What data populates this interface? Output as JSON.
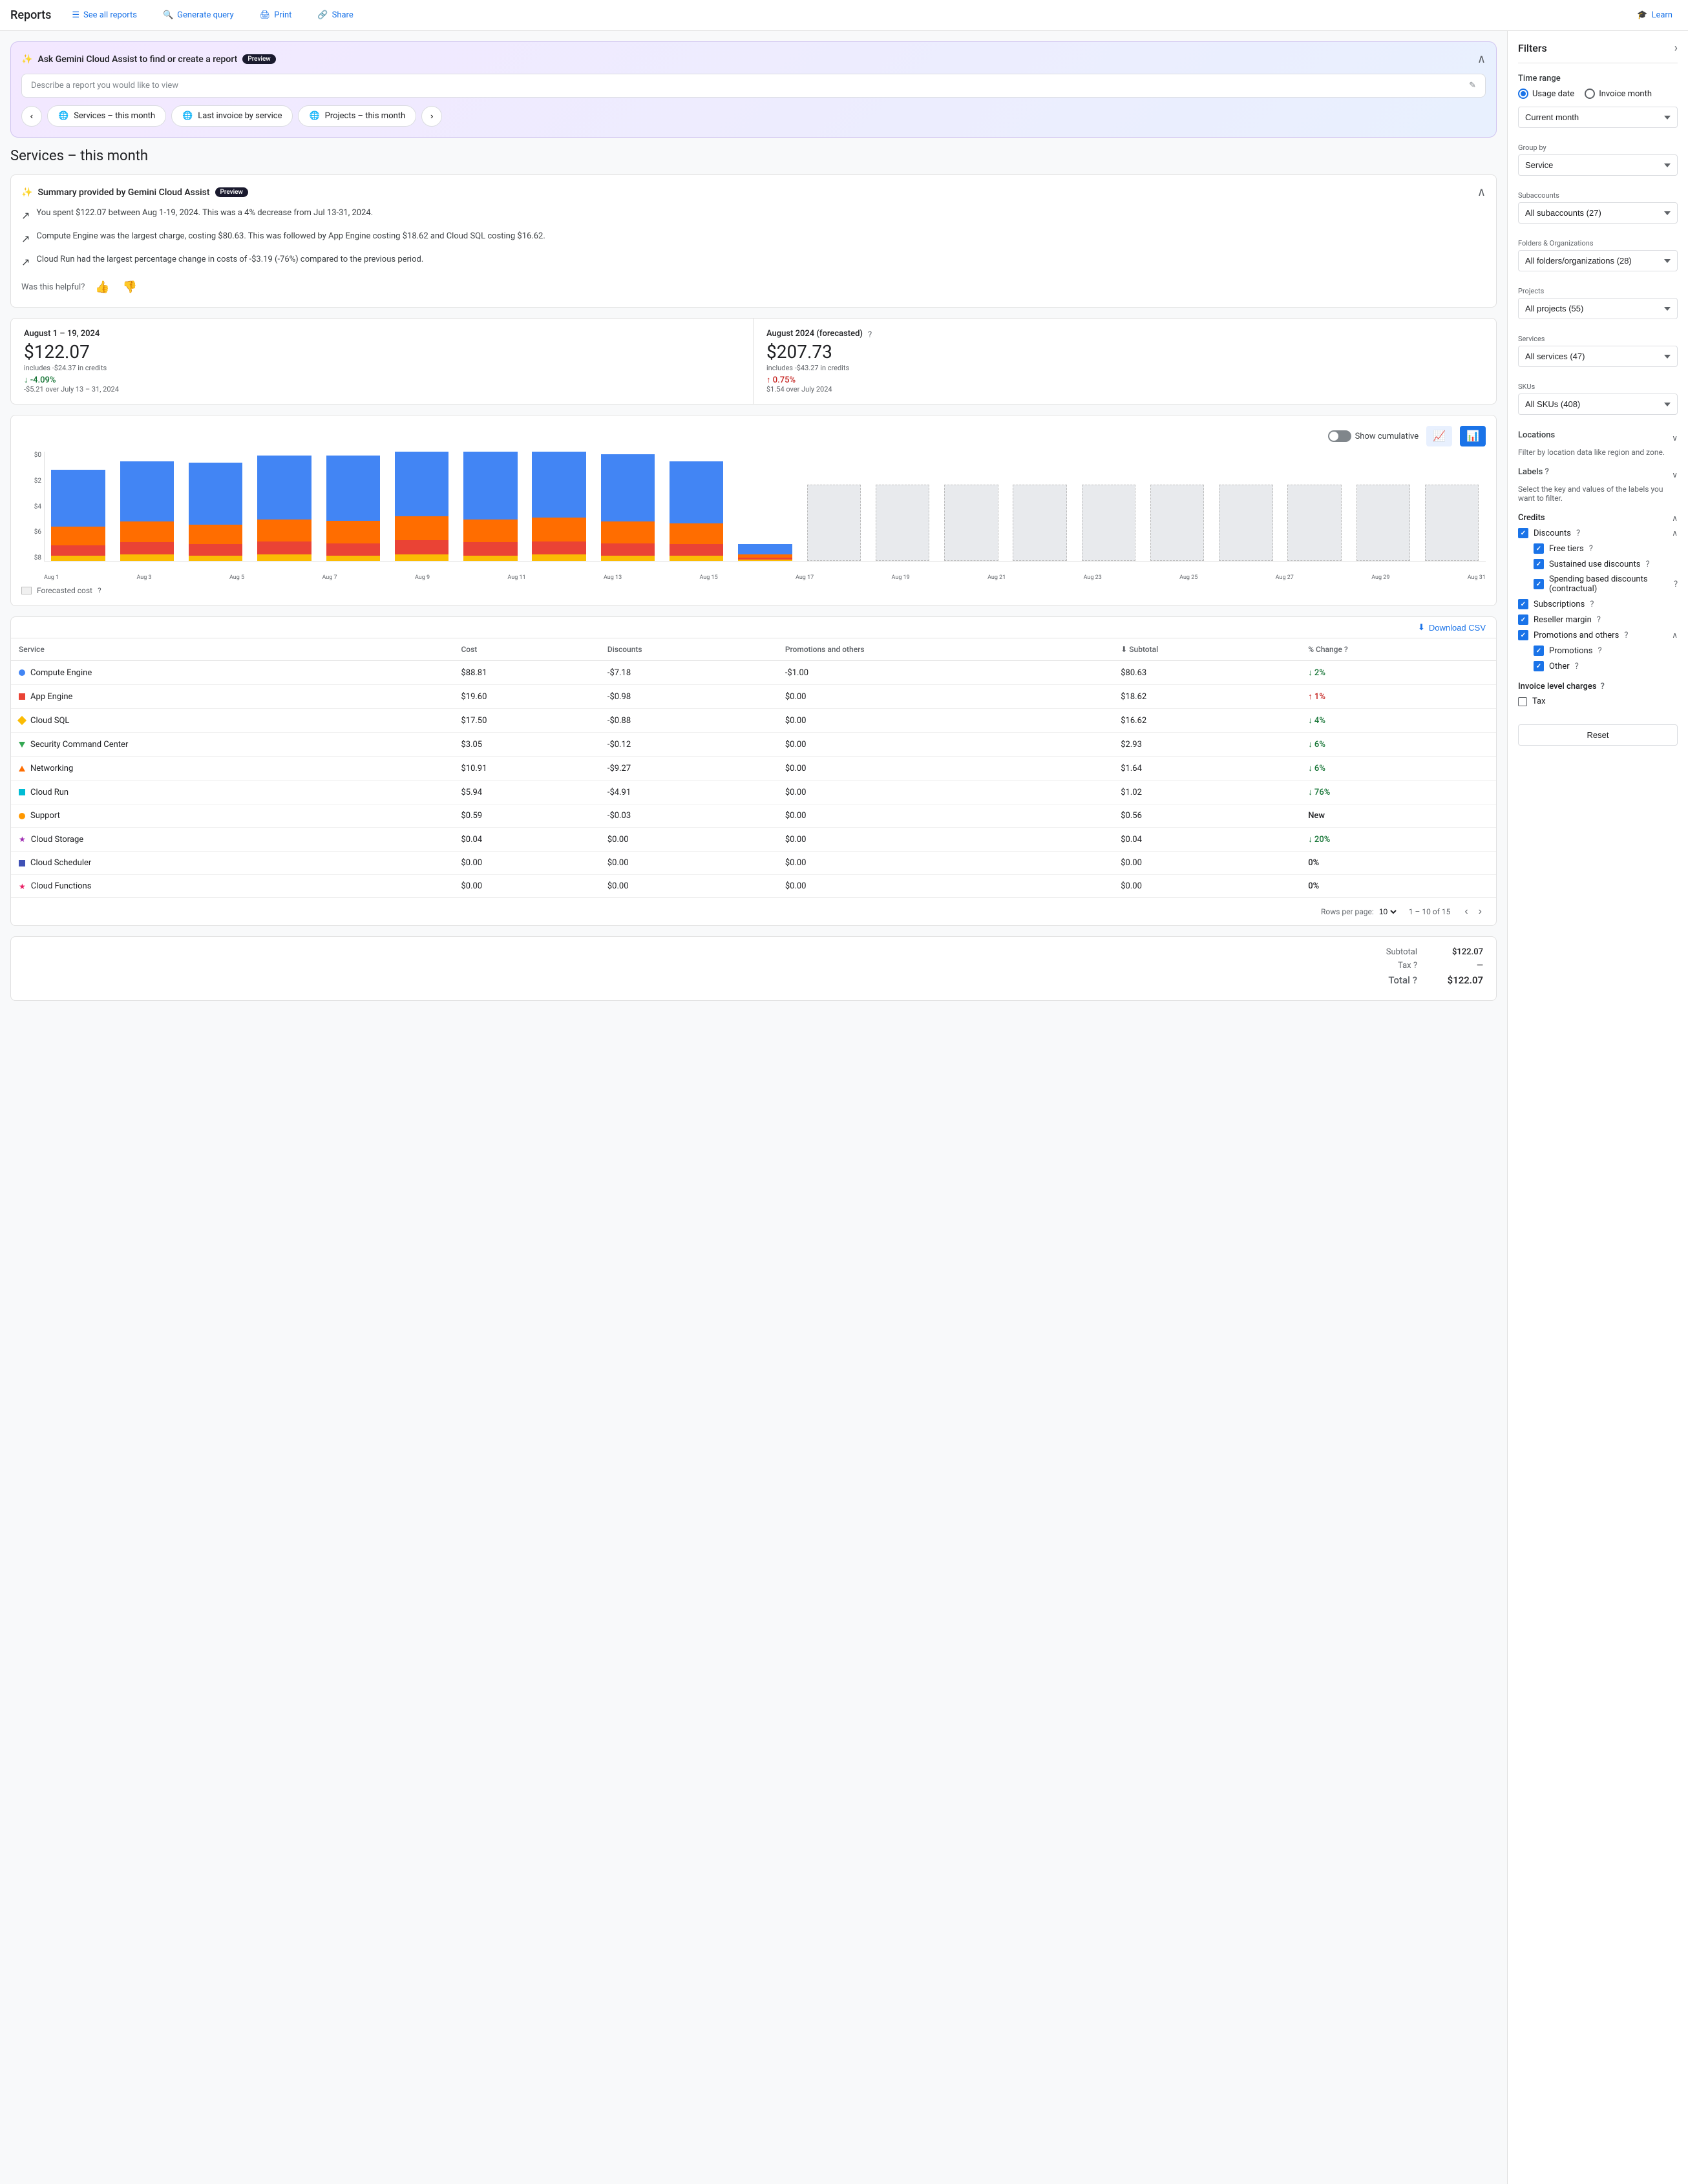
{
  "nav": {
    "title": "Reports",
    "links": [
      {
        "label": "See all reports",
        "icon": "☰"
      },
      {
        "label": "Generate query",
        "icon": "🔍"
      },
      {
        "label": "Print",
        "icon": "🖨"
      },
      {
        "label": "Share",
        "icon": "🔗"
      },
      {
        "label": "Learn",
        "icon": "🎓"
      }
    ]
  },
  "gemini": {
    "title": "Ask Gemini Cloud Assist to find or create a report",
    "preview_badge": "Preview",
    "input_placeholder": "Describe a report you would like to view",
    "chips": [
      {
        "label": "Services – this month"
      },
      {
        "label": "Last invoice by service"
      },
      {
        "label": "Projects – this month"
      }
    ]
  },
  "page": {
    "title": "Services – this month"
  },
  "summary": {
    "title": "Summary provided by Gemini Cloud Assist",
    "preview_badge": "Preview",
    "points": [
      "You spent $122.07 between Aug 1-19, 2024. This was a 4% decrease from Jul 13-31, 2024.",
      "Compute Engine was the largest charge, costing $80.63. This was followed by App Engine costing $18.62 and Cloud SQL costing $16.62.",
      "Cloud Run had the largest percentage change in costs of -$3.19 (-76%) compared to the previous period."
    ],
    "helpful_label": "Was this helpful?"
  },
  "stats": {
    "current": {
      "period": "August 1 – 19, 2024",
      "amount": "$122.07",
      "includes": "includes -$24.37 in credits",
      "change_pct": "↓ -4.09%",
      "change_class": "green",
      "change_sub": "-$5.21 over July 13 – 31, 2024"
    },
    "forecasted": {
      "period": "August 2024 (forecasted)",
      "amount": "$207.73",
      "includes": "includes -$43.27 in credits",
      "change_pct": "↑ 0.75%",
      "change_class": "red",
      "change_sub": "$1.54 over July 2024"
    }
  },
  "chart": {
    "show_cumulative": "Show cumulative",
    "y_labels": [
      "$8",
      "$6",
      "$4",
      "$2",
      "$0"
    ],
    "x_labels": [
      "Aug 1",
      "Aug 3",
      "Aug 5",
      "Aug 7",
      "Aug 9",
      "Aug 11",
      "Aug 13",
      "Aug 15",
      "Aug 17",
      "Aug 19",
      "Aug 21",
      "Aug 23",
      "Aug 25",
      "Aug 27",
      "Aug 29",
      "Aug 31"
    ],
    "forecasted_legend": "Forecasted cost",
    "bars": [
      {
        "blue": 55,
        "orange": 18,
        "red": 10,
        "yellow": 5,
        "forecasted": false
      },
      {
        "blue": 58,
        "orange": 20,
        "red": 12,
        "yellow": 6,
        "forecasted": false
      },
      {
        "blue": 60,
        "orange": 19,
        "red": 11,
        "yellow": 5,
        "forecasted": false
      },
      {
        "blue": 62,
        "orange": 21,
        "red": 13,
        "yellow": 6,
        "forecasted": false
      },
      {
        "blue": 63,
        "orange": 22,
        "red": 12,
        "yellow": 5,
        "forecasted": false
      },
      {
        "blue": 65,
        "orange": 23,
        "red": 14,
        "yellow": 6,
        "forecasted": false
      },
      {
        "blue": 66,
        "orange": 22,
        "red": 13,
        "yellow": 5,
        "forecasted": false
      },
      {
        "blue": 67,
        "orange": 23,
        "red": 13,
        "yellow": 6,
        "forecasted": false
      },
      {
        "blue": 65,
        "orange": 21,
        "red": 12,
        "yellow": 5,
        "forecasted": false
      },
      {
        "blue": 60,
        "orange": 20,
        "red": 11,
        "yellow": 5,
        "forecasted": false
      },
      {
        "blue": 10,
        "orange": 3,
        "red": 2,
        "yellow": 1,
        "forecasted": false
      },
      {
        "blue": 0,
        "orange": 0,
        "red": 0,
        "yellow": 0,
        "forecasted": true
      },
      {
        "blue": 0,
        "orange": 0,
        "red": 0,
        "yellow": 0,
        "forecasted": true
      },
      {
        "blue": 0,
        "orange": 0,
        "red": 0,
        "yellow": 0,
        "forecasted": true
      },
      {
        "blue": 0,
        "orange": 0,
        "red": 0,
        "yellow": 0,
        "forecasted": true
      },
      {
        "blue": 0,
        "orange": 0,
        "red": 0,
        "yellow": 0,
        "forecasted": true
      },
      {
        "blue": 0,
        "orange": 0,
        "red": 0,
        "yellow": 0,
        "forecasted": true
      },
      {
        "blue": 0,
        "orange": 0,
        "red": 0,
        "yellow": 0,
        "forecasted": true
      },
      {
        "blue": 0,
        "orange": 0,
        "red": 0,
        "yellow": 0,
        "forecasted": true
      },
      {
        "blue": 0,
        "orange": 0,
        "red": 0,
        "yellow": 0,
        "forecasted": true
      },
      {
        "blue": 0,
        "orange": 0,
        "red": 0,
        "yellow": 0,
        "forecasted": true
      }
    ]
  },
  "table": {
    "download_label": "Download CSV",
    "columns": [
      "Service",
      "Cost",
      "Discounts",
      "Promotions and others",
      "Subtotal",
      "% Change"
    ],
    "rows": [
      {
        "service": "Compute Engine",
        "color": "#4285F4",
        "shape": "circle",
        "cost": "$88.81",
        "discounts": "-$7.18",
        "promotions": "-$1.00",
        "subtotal": "$80.63",
        "change": "↓ 2%",
        "change_class": "green"
      },
      {
        "service": "App Engine",
        "color": "#EA4335",
        "shape": "square",
        "cost": "$19.60",
        "discounts": "-$0.98",
        "promotions": "$0.00",
        "subtotal": "$18.62",
        "change": "↑ 1%",
        "change_class": "red"
      },
      {
        "service": "Cloud SQL",
        "color": "#FBBC04",
        "shape": "diamond",
        "cost": "$17.50",
        "discounts": "-$0.88",
        "promotions": "$0.00",
        "subtotal": "$16.62",
        "change": "↓ 4%",
        "change_class": "green"
      },
      {
        "service": "Security Command Center",
        "color": "#34A853",
        "shape": "triangle-down",
        "cost": "$3.05",
        "discounts": "-$0.12",
        "promotions": "$0.00",
        "subtotal": "$2.93",
        "change": "↓ 6%",
        "change_class": "green"
      },
      {
        "service": "Networking",
        "color": "#FF6D00",
        "shape": "triangle-up",
        "cost": "$10.91",
        "discounts": "-$9.27",
        "promotions": "$0.00",
        "subtotal": "$1.64",
        "change": "↓ 6%",
        "change_class": "green"
      },
      {
        "service": "Cloud Run",
        "color": "#00BCD4",
        "shape": "square",
        "cost": "$5.94",
        "discounts": "-$4.91",
        "promotions": "$0.00",
        "subtotal": "$1.02",
        "change": "↓ 76%",
        "change_class": "green"
      },
      {
        "service": "Support",
        "color": "#FF9800",
        "shape": "circle",
        "cost": "$0.59",
        "discounts": "-$0.03",
        "promotions": "$0.00",
        "subtotal": "$0.56",
        "change": "New",
        "change_class": ""
      },
      {
        "service": "Cloud Storage",
        "color": "#9C27B0",
        "shape": "star",
        "cost": "$0.04",
        "discounts": "$0.00",
        "promotions": "$0.00",
        "subtotal": "$0.04",
        "change": "↓ 20%",
        "change_class": "green"
      },
      {
        "service": "Cloud Scheduler",
        "color": "#3F51B5",
        "shape": "square",
        "cost": "$0.00",
        "discounts": "$0.00",
        "promotions": "$0.00",
        "subtotal": "$0.00",
        "change": "0%",
        "change_class": ""
      },
      {
        "service": "Cloud Functions",
        "color": "#E91E63",
        "shape": "star",
        "cost": "$0.00",
        "discounts": "$0.00",
        "promotions": "$0.00",
        "subtotal": "$0.00",
        "change": "0%",
        "change_class": ""
      }
    ],
    "pagination": {
      "rows_per_page_label": "Rows per page:",
      "rows_per_page": "10",
      "page_info": "1 – 10 of 15"
    }
  },
  "totals": {
    "subtotal_label": "Subtotal",
    "subtotal_value": "$122.07",
    "tax_label": "Tax",
    "tax_help": "?",
    "tax_value": "—",
    "total_label": "Total",
    "total_help": "?",
    "total_value": "$122.07"
  },
  "filters": {
    "title": "Filters",
    "time_range_label": "Time range",
    "usage_date_label": "Usage date",
    "invoice_month_label": "Invoice month",
    "current_month_label": "Current month",
    "group_by_label": "Group by",
    "group_by_value": "Service",
    "subaccounts_label": "Subaccounts",
    "subaccounts_value": "All subaccounts (27)",
    "folders_label": "Folders & Organizations",
    "folders_value": "All folders/organizations (28)",
    "projects_label": "Projects",
    "projects_value": "All projects (55)",
    "services_label": "Services",
    "services_value": "All services (47)",
    "skus_label": "SKUs",
    "skus_value": "All SKUs (408)",
    "locations_label": "Locations",
    "locations_desc": "Filter by location data like region and zone.",
    "labels_label": "Labels",
    "labels_desc": "Select the key and values of the labels you want to filter.",
    "credits_label": "Credits",
    "discounts_label": "Discounts",
    "free_tiers_label": "Free tiers",
    "sustained_label": "Sustained use discounts",
    "spending_label": "Spending based discounts (contractual)",
    "subscriptions_label": "Subscriptions",
    "reseller_label": "Reseller margin",
    "promotions_others_label": "Promotions and others",
    "promotions_label": "Promotions",
    "other_label": "Other",
    "invoice_charges_label": "Invoice level charges",
    "tax_label": "Tax",
    "reset_label": "Reset"
  }
}
